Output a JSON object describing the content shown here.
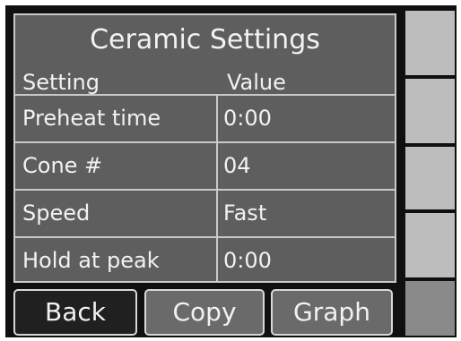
{
  "panel": {
    "title": "Ceramic Settings",
    "header_setting": "Setting",
    "header_value": "Value"
  },
  "settings": [
    {
      "name": "Preheat time",
      "value": "0:00"
    },
    {
      "name": "Cone #",
      "value": "04"
    },
    {
      "name": "Speed",
      "value": "Fast"
    },
    {
      "name": "Hold at peak",
      "value": "0:00"
    }
  ],
  "buttons": {
    "back": "Back",
    "copy": "Copy",
    "graph": "Graph"
  },
  "colors": {
    "panel": "#5e5e5e",
    "frame": "#101010",
    "back_button": "#202020",
    "button": "#6a6a6a",
    "side_box": "#bdbdbd"
  }
}
